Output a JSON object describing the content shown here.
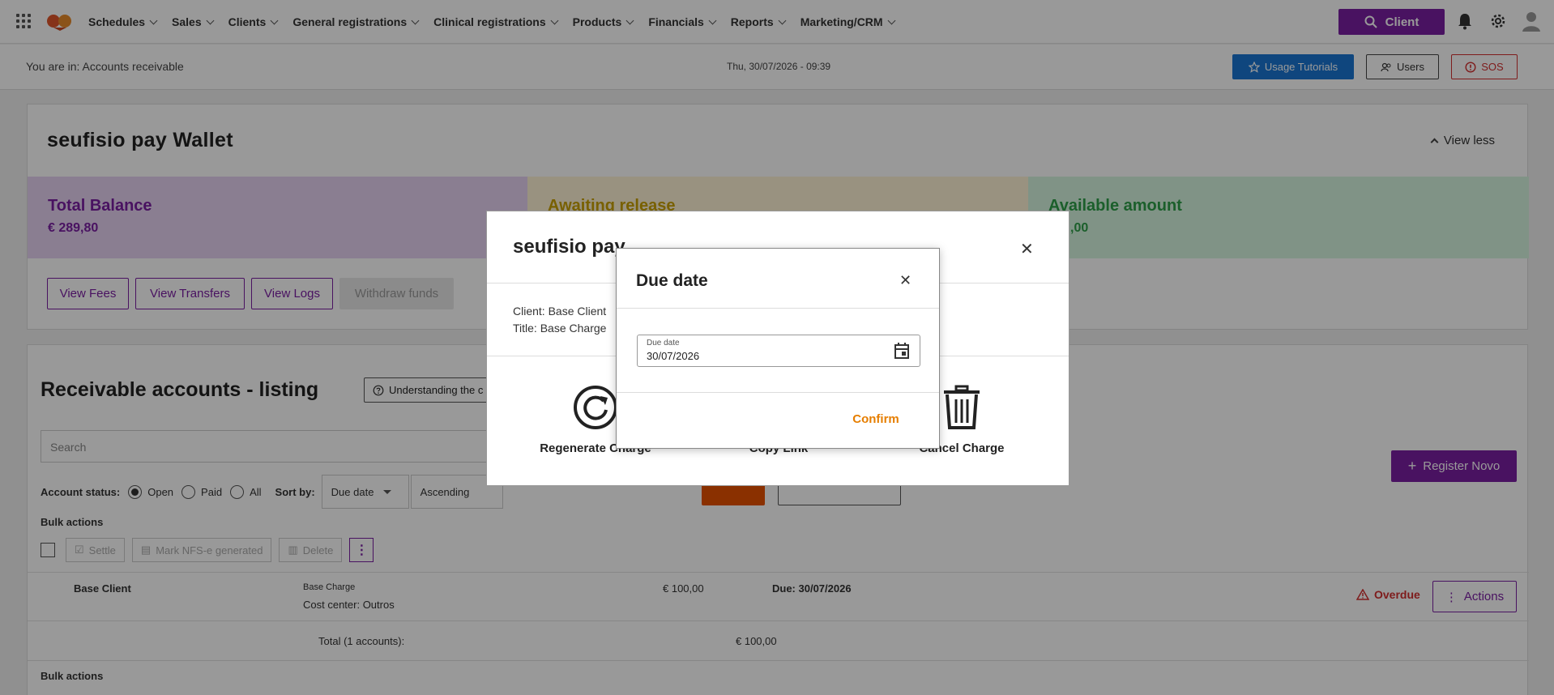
{
  "topnav": {
    "menu": [
      "Schedules",
      "Sales",
      "Clients",
      "General registrations",
      "Clinical registrations",
      "Products",
      "Financials",
      "Reports",
      "Marketing/CRM"
    ],
    "client_button": "Client"
  },
  "subheader": {
    "breadcrumb": "You are in: Accounts receivable",
    "datetime": "Thu, 30/07/2026 - 09:39",
    "tutorials": "Usage Tutorials",
    "users": "Users",
    "sos": "SOS"
  },
  "wallet": {
    "title": "seufisio pay Wallet",
    "view_less": "View less",
    "total_label": "Total Balance",
    "total_value": "€ 289,80",
    "awaiting_label": "Awaiting release",
    "available_label": "Available amount",
    "available_value": ",00",
    "buttons": [
      "View Fees",
      "View Transfers",
      "View Logs",
      "Withdraw funds"
    ]
  },
  "listing": {
    "title": "Receivable accounts - listing",
    "understanding": "Understanding the c",
    "search_placeholder": "Search",
    "status_label": "Account status:",
    "status_options": [
      "Open",
      "Paid",
      "All"
    ],
    "sort_label": "Sort by:",
    "sort_field": "Due date",
    "sort_order": "Ascending",
    "register_button": "Register Novo",
    "bulk_label": "Bulk actions",
    "bulk_buttons": [
      "Settle",
      "Mark NFS-e generated",
      "Delete"
    ],
    "row": {
      "client": "Base Client",
      "charge": "Base Charge",
      "cost_center": "Cost center: Outros",
      "amount": "€ 100,00",
      "due": "Due: 30/07/2026",
      "status": "Overdue",
      "actions": "Actions"
    },
    "total_label": "Total (1 accounts):",
    "total_value": "€ 100,00"
  },
  "modal_pay": {
    "title": "seufisio pay",
    "client": "Client: Base Client",
    "charge_title": "Title: Base Charge",
    "actions": [
      "Regenerate Charge",
      "Copy Link",
      "Cancel Charge"
    ]
  },
  "modal_due": {
    "title": "Due date",
    "field_label": "Due date",
    "field_value": "30/07/2026",
    "confirm": "Confirm"
  },
  "colors": {
    "brand_purple": "#7b1fa2",
    "overdue_red": "#d32f2f",
    "confirm_orange": "#e67e00",
    "tutorial_blue": "#1976d2"
  }
}
